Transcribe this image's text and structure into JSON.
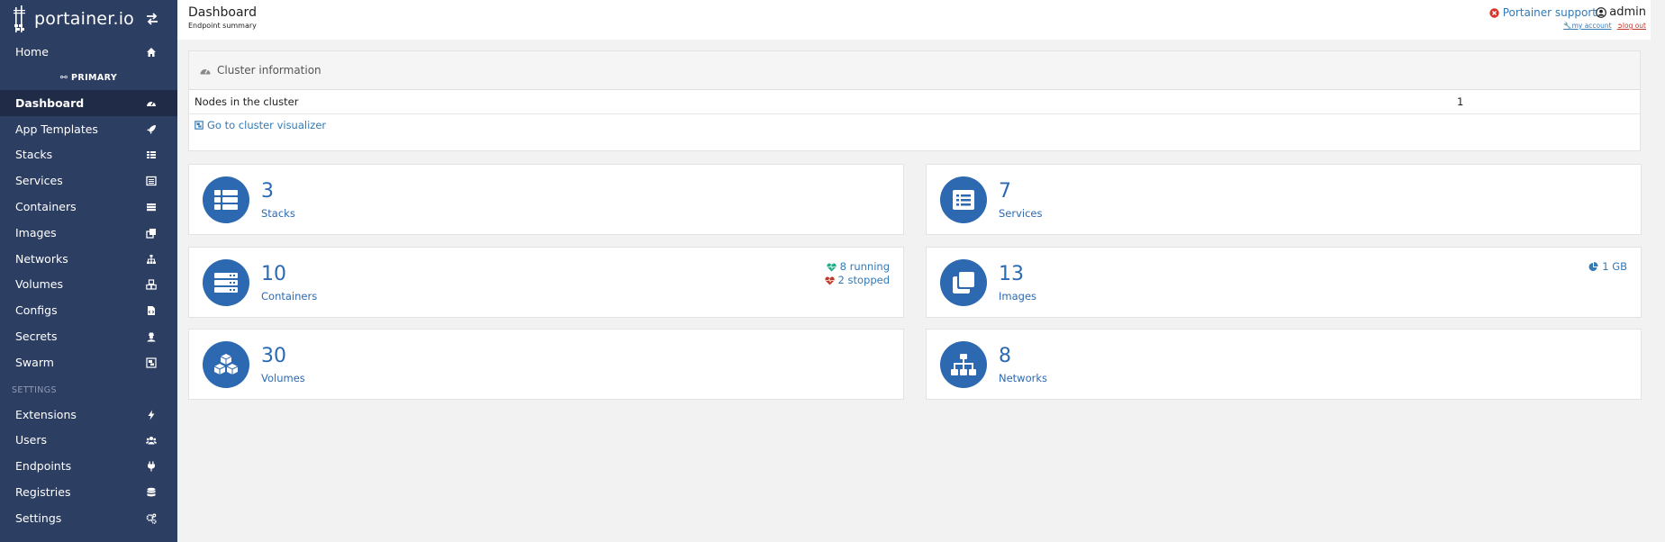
{
  "brand": {
    "name": "portainer.io"
  },
  "sidebar": {
    "home": "Home",
    "endpoint": "PRIMARY",
    "items": [
      {
        "label": "Dashboard",
        "icon": "tachometer-icon"
      },
      {
        "label": "App Templates",
        "icon": "rocket-icon"
      },
      {
        "label": "Stacks",
        "icon": "th-list-icon"
      },
      {
        "label": "Services",
        "icon": "list-alt-icon"
      },
      {
        "label": "Containers",
        "icon": "server-icon"
      },
      {
        "label": "Images",
        "icon": "clone-icon"
      },
      {
        "label": "Networks",
        "icon": "sitemap-icon"
      },
      {
        "label": "Volumes",
        "icon": "cubes-icon"
      },
      {
        "label": "Configs",
        "icon": "file-code-icon"
      },
      {
        "label": "Secrets",
        "icon": "user-secret-icon"
      },
      {
        "label": "Swarm",
        "icon": "object-group-icon"
      }
    ],
    "settings_header": "SETTINGS",
    "settings_items": [
      {
        "label": "Extensions",
        "icon": "bolt-icon"
      },
      {
        "label": "Users",
        "icon": "users-icon"
      },
      {
        "label": "Endpoints",
        "icon": "plug-icon"
      },
      {
        "label": "Registries",
        "icon": "database-icon"
      },
      {
        "label": "Settings",
        "icon": "cogs-icon"
      }
    ]
  },
  "header": {
    "title": "Dashboard",
    "subtitle": "Endpoint summary",
    "support": "Portainer support",
    "user": "admin",
    "my_account": "my account",
    "log_out": "log out"
  },
  "cluster": {
    "title": "Cluster information",
    "nodes_label": "Nodes in the cluster",
    "nodes_value": "1",
    "visualizer_link": "Go to cluster visualizer"
  },
  "tiles": {
    "stacks": {
      "count": "3",
      "label": "Stacks"
    },
    "services": {
      "count": "7",
      "label": "Services"
    },
    "containers": {
      "count": "10",
      "label": "Containers",
      "running": "8 running",
      "stopped": "2 stopped"
    },
    "images": {
      "count": "13",
      "label": "Images",
      "size": "1 GB"
    },
    "volumes": {
      "count": "30",
      "label": "Volumes"
    },
    "networks": {
      "count": "8",
      "label": "Networks"
    }
  },
  "colors": {
    "sidebar_bg": "#2d3e63",
    "sidebar_active": "#1f2b47",
    "accent": "#2c69b1",
    "running": "#23ae89",
    "stopped": "#c0392b"
  }
}
